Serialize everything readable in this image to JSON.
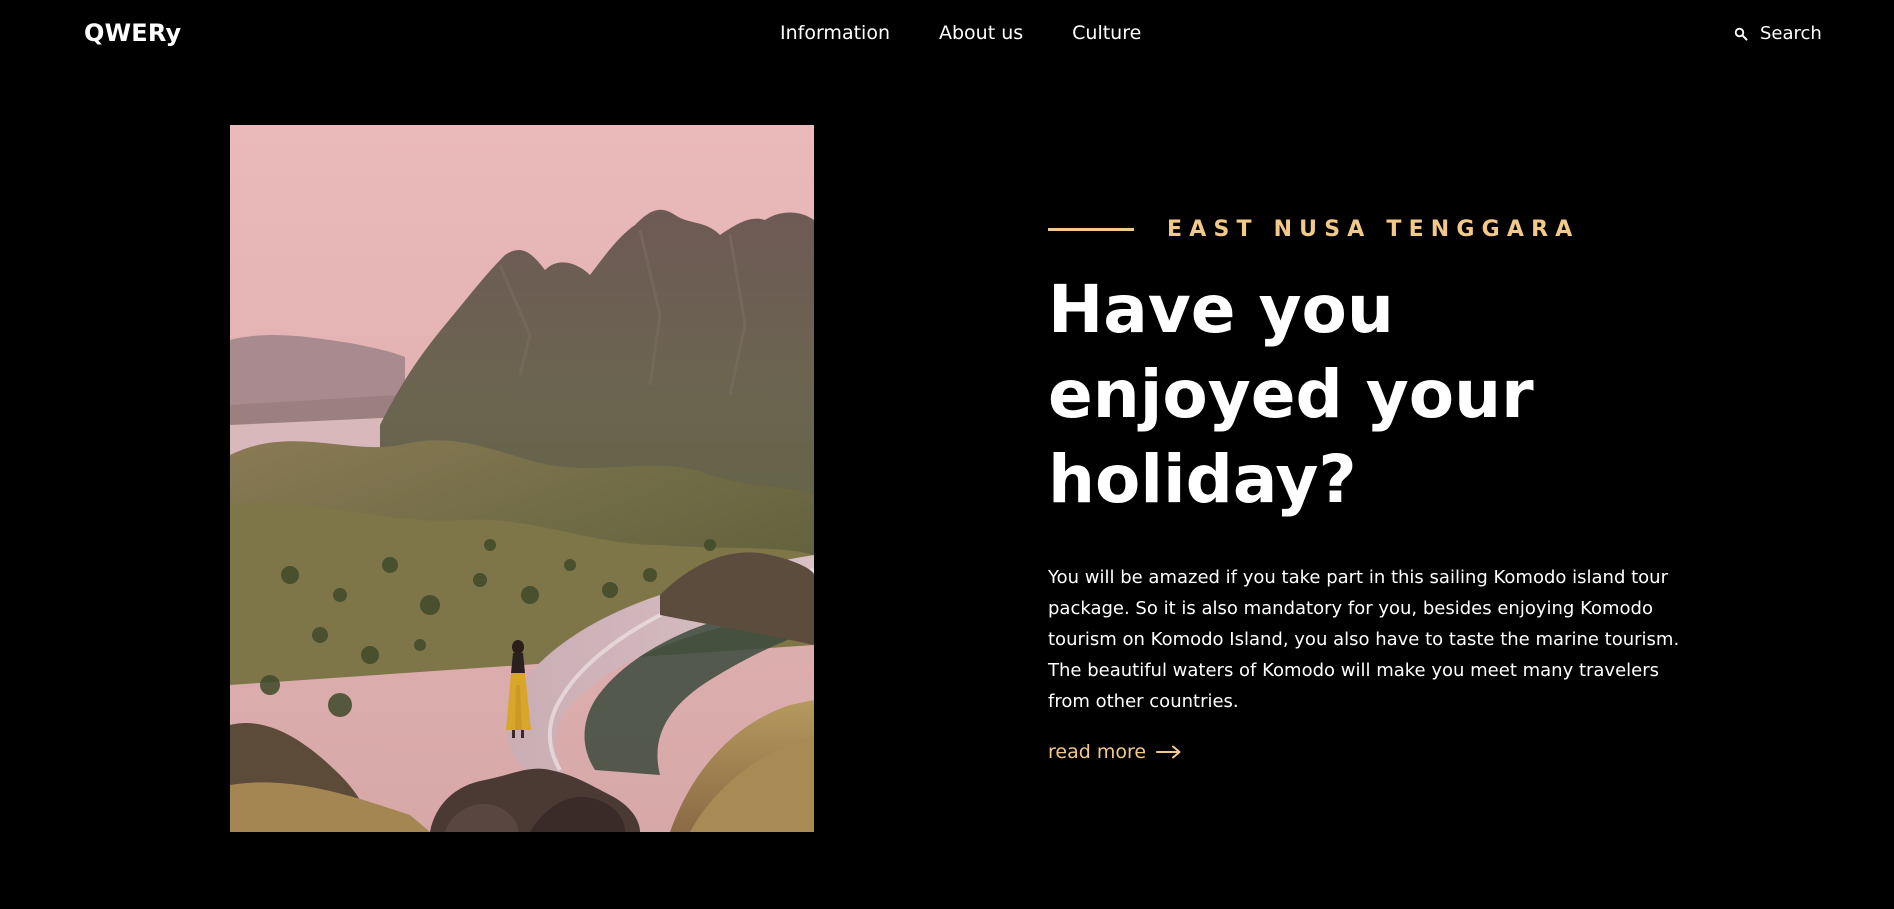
{
  "header": {
    "logo": "QWERy",
    "nav": [
      {
        "label": "Information"
      },
      {
        "label": "About us"
      },
      {
        "label": "Culture"
      }
    ],
    "search": {
      "icon": "search-icon",
      "label": "Search"
    }
  },
  "hero": {
    "image": {
      "alt": "Woman in a yellow dress standing on a rock overlooking a curving bay and green hills at sunset"
    },
    "eyebrow": "EAST NUSA TENGGARA",
    "heading": "Have you enjoyed your holiday?",
    "body": "You will be amazed if you take part in this sailing Komodo island tour package. So it is also mandatory for you, besides enjoying Komodo tourism on Komodo Island, you also have to taste the marine tourism. The beautiful waters of Komodo will make you meet many travelers from other countries.",
    "cta": {
      "label": "read more",
      "icon": "arrow-right-icon"
    }
  },
  "colors": {
    "background": "#000000",
    "text": "#ffffff",
    "accent": "#f3c98a"
  }
}
